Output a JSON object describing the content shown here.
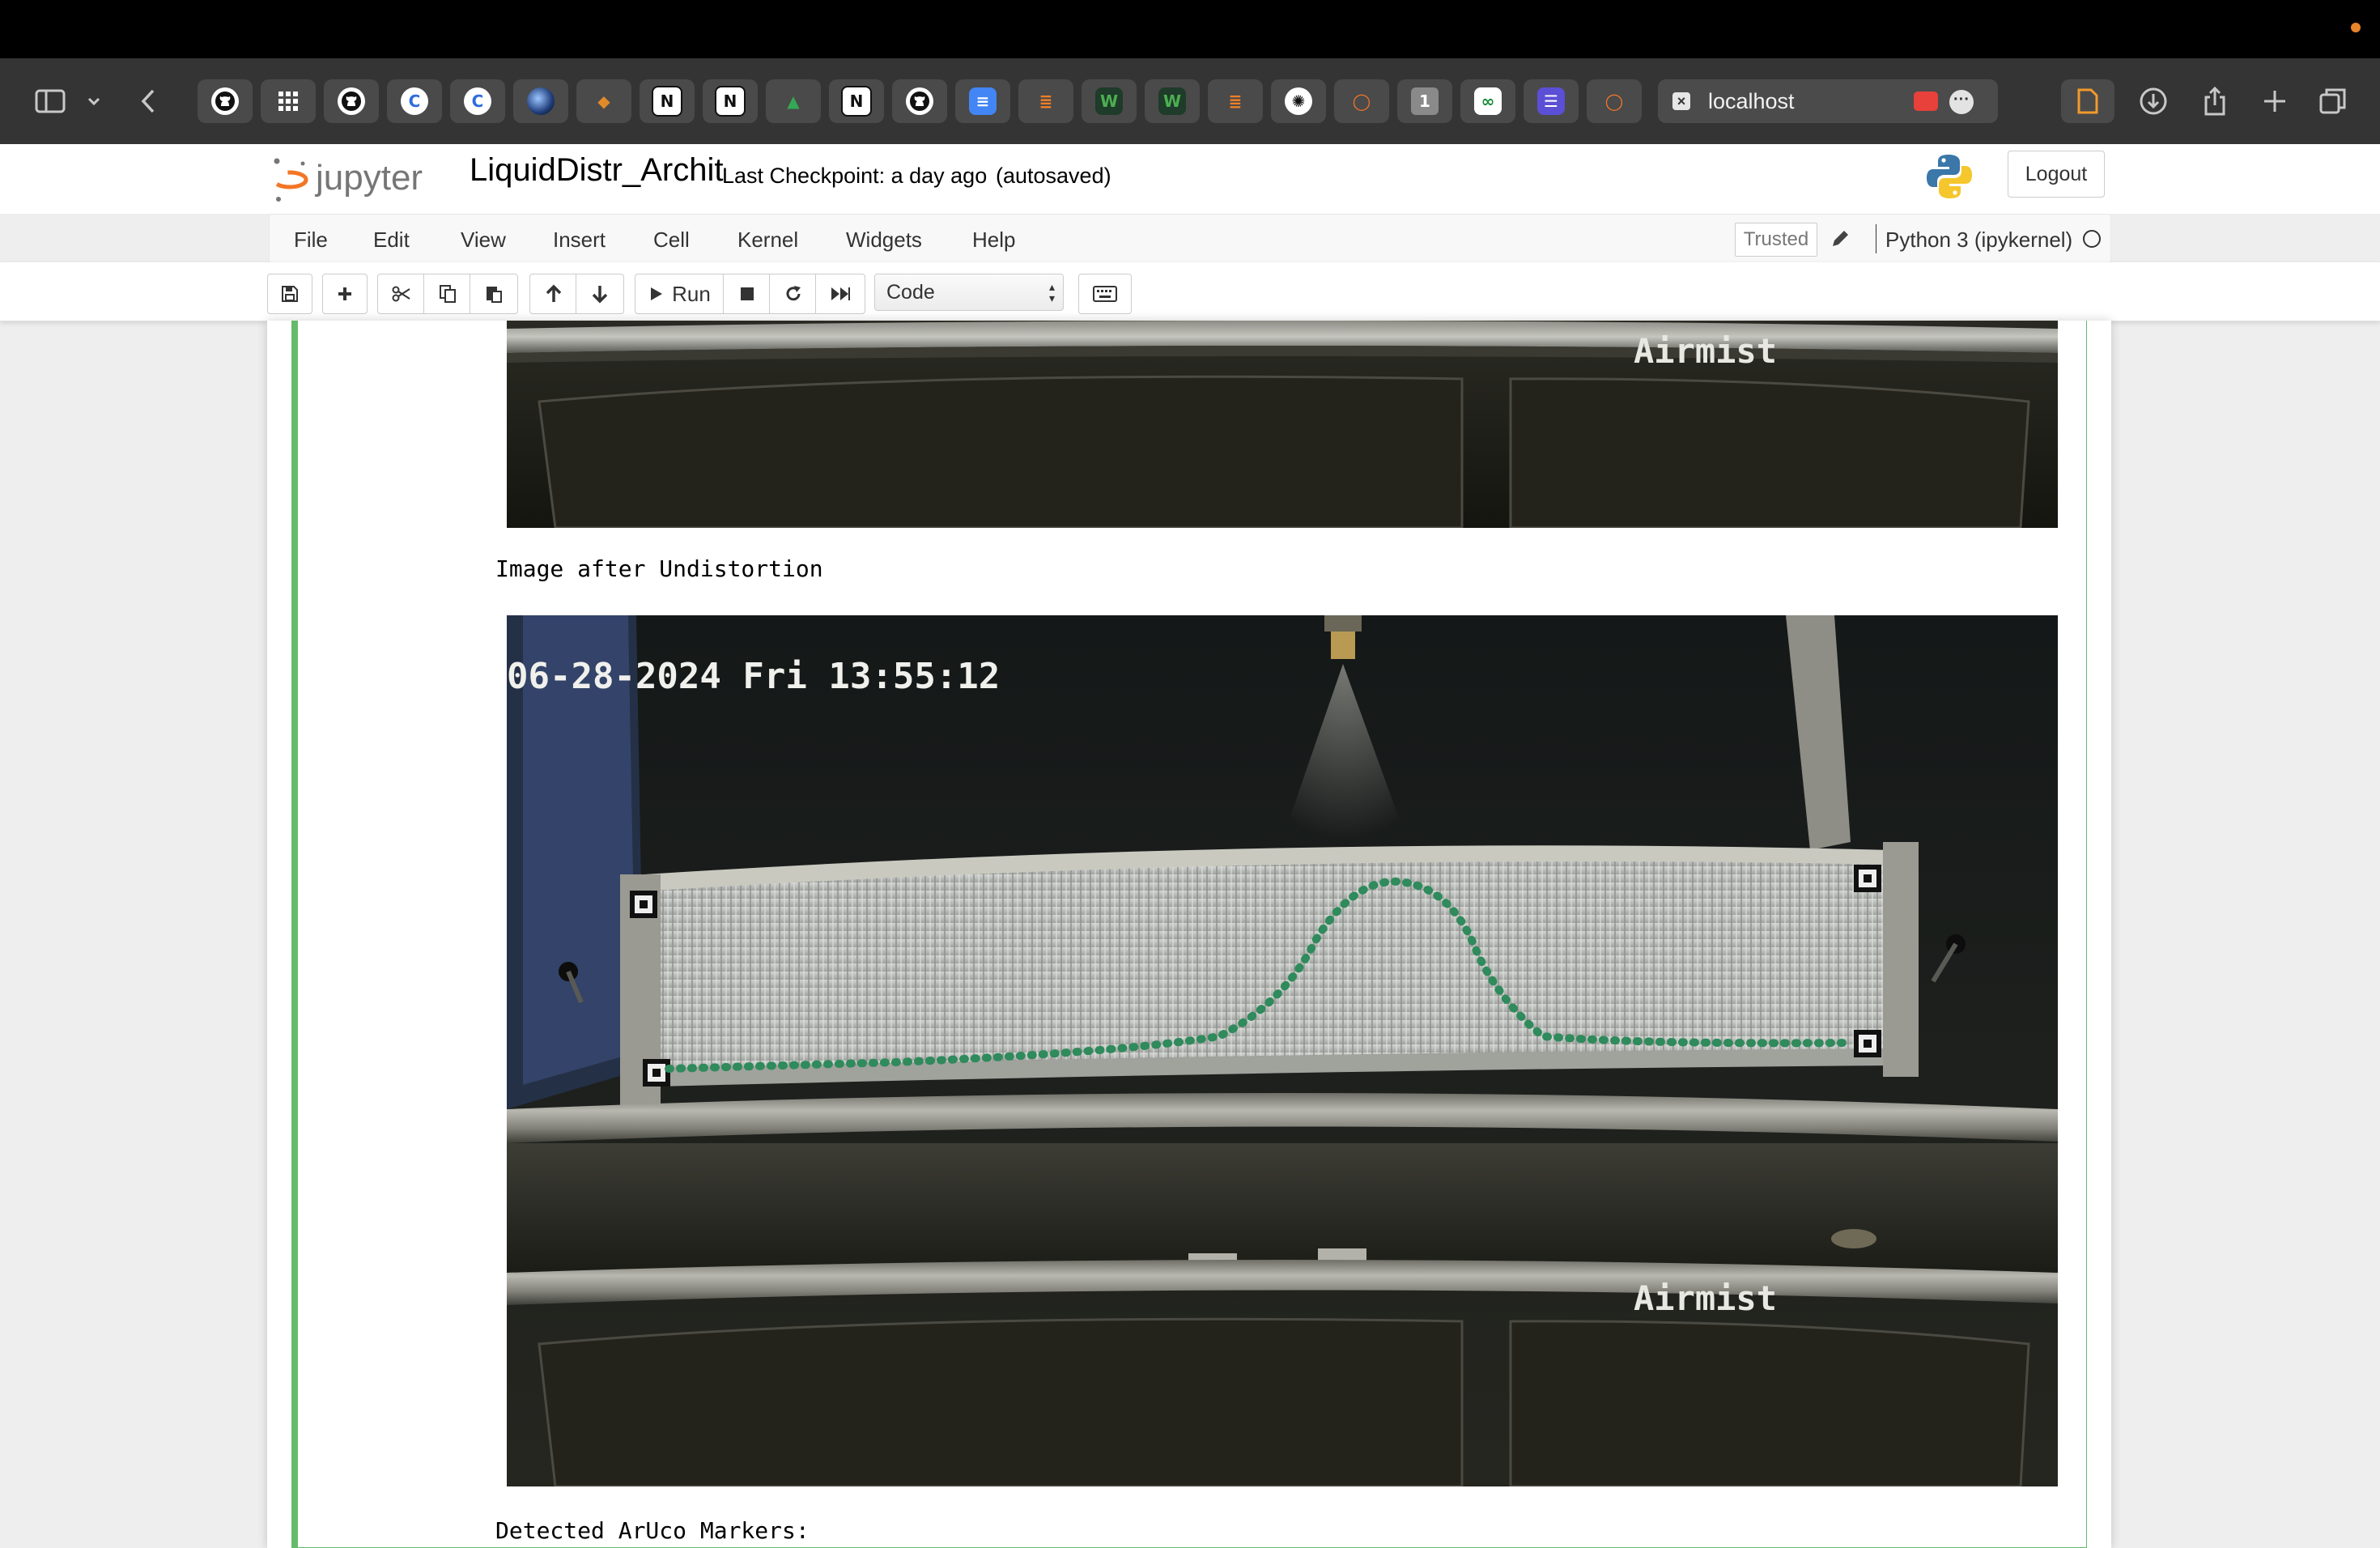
{
  "browser": {
    "address": "localhost",
    "tabs": [
      {
        "icon": "github-icon",
        "glyph": "",
        "color": "#ffffff"
      },
      {
        "icon": "apps-grid-icon",
        "glyph": "",
        "color": "#ffffff"
      },
      {
        "icon": "github-icon",
        "glyph": "",
        "color": "#ffffff"
      },
      {
        "icon": "c-logo-icon",
        "glyph": "C",
        "color": "#2d6cdf"
      },
      {
        "icon": "c-logo-icon",
        "glyph": "C",
        "color": "#2d6cdf"
      },
      {
        "icon": "orb-icon",
        "glyph": "",
        "color": "#3a78c8"
      },
      {
        "icon": "diamond-icon",
        "glyph": "◆",
        "color": "#e08b2a"
      },
      {
        "icon": "notion-icon",
        "glyph": "N",
        "color": "#ffffff"
      },
      {
        "icon": "notion-icon",
        "glyph": "N",
        "color": "#ffffff"
      },
      {
        "icon": "google-drive-icon",
        "glyph": "▲",
        "color": "#34a853"
      },
      {
        "icon": "notion-icon",
        "glyph": "N",
        "color": "#ffffff"
      },
      {
        "icon": "github-icon",
        "glyph": "",
        "color": "#ffffff"
      },
      {
        "icon": "google-docs-icon",
        "glyph": "≡",
        "color": "#4285f4"
      },
      {
        "icon": "stackoverflow-icon",
        "glyph": "≣",
        "color": "#f48024"
      },
      {
        "icon": "w-logo-icon",
        "glyph": "W",
        "color": "#2e7d32"
      },
      {
        "icon": "w-logo-icon",
        "glyph": "W",
        "color": "#2e7d32"
      },
      {
        "icon": "stackoverflow-icon",
        "glyph": "≣",
        "color": "#f48024"
      },
      {
        "icon": "openai-icon",
        "glyph": "✺",
        "color": "#ffffff"
      },
      {
        "icon": "jupyter-tab-icon",
        "glyph": "◯",
        "color": "#f37626"
      },
      {
        "icon": "number-one-icon",
        "glyph": "1",
        "color": "#8a8a8a"
      },
      {
        "icon": "overleaf-icon",
        "glyph": "∞",
        "color": "#ffffff"
      },
      {
        "icon": "list-app-icon",
        "glyph": "☰",
        "color": "#5b4fd6"
      },
      {
        "icon": "jupyter-tab-icon",
        "glyph": "◯",
        "color": "#f37626"
      }
    ]
  },
  "jupyter": {
    "logo_text": "jupyter",
    "notebook_title": "LiquidDistr_Archit",
    "checkpoint": "Last Checkpoint: a day ago",
    "autosave": "(autosaved)",
    "logout": "Logout"
  },
  "menu": {
    "items": [
      "File",
      "Edit",
      "View",
      "Insert",
      "Cell",
      "Kernel",
      "Widgets",
      "Help"
    ],
    "trusted": "Trusted",
    "kernel": "Python 3 (ipykernel)"
  },
  "toolbar": {
    "run_label": "Run",
    "cell_type": "Code"
  },
  "output": {
    "label_undistortion": "Image after Undistortion",
    "label_aruco": "Detected ArUco Markers:",
    "image_brand": "Airmist",
    "image_timestamp": "06-28-2024 Fri 13:55:12"
  },
  "colors": {
    "accent_green": "#66bb6a",
    "jupyter_orange": "#f37626"
  }
}
